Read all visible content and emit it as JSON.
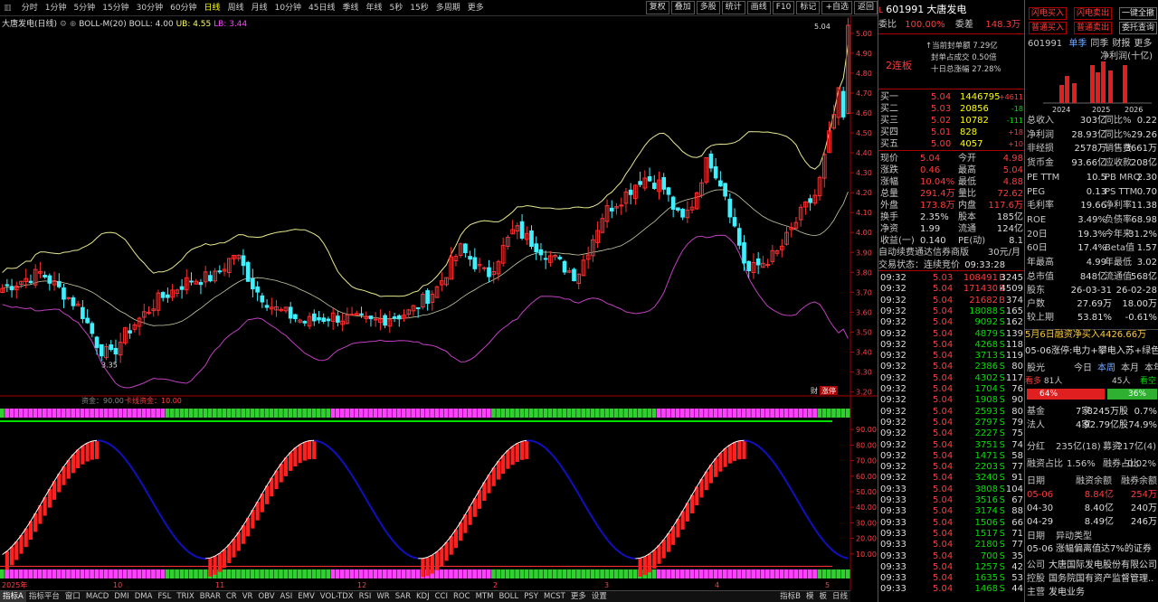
{
  "toolbar": {
    "tabs": [
      "分时",
      "1分钟",
      "5分钟",
      "15分钟",
      "30分钟",
      "60分钟",
      "日线",
      "周线",
      "月线",
      "10分钟",
      "45日线",
      "季线",
      "年线",
      "5秒",
      "15秒",
      "多周期",
      "更多"
    ],
    "active_tab": "日线",
    "buttons": [
      "复权",
      "叠加",
      "多股",
      "统计",
      "画线",
      "F10",
      "标记",
      "+自选",
      "返回"
    ]
  },
  "chart": {
    "title_name": "大唐发电(日线)",
    "indicator": "BOLL-M(20)",
    "boll": "BOLL: 4.00",
    "ub": "UB: 4.55",
    "lb": "LB: 3.44",
    "price_axis": [
      "5.00",
      "4.90",
      "4.80",
      "4.70",
      "4.60",
      "4.50",
      "4.40",
      "4.30",
      "4.20",
      "4.10",
      "4.00",
      "3.90",
      "3.80",
      "3.70",
      "3.60",
      "3.50",
      "3.40",
      "3.30",
      "3.20"
    ],
    "high_label": "5.04",
    "low_label": "3.35",
    "sub_label1": "资金：90.00",
    "sub_label2": "卡线资金：10.00",
    "osc_axis": [
      "90.00",
      "80.00",
      "70.00",
      "60.00",
      "50.00",
      "40.00",
      "30.00",
      "20.00",
      "10.00"
    ],
    "x_axis": [
      "2025年",
      "10",
      "11",
      "12",
      "2",
      "3",
      "4",
      "5"
    ],
    "corner1": "财",
    "corner2": "涨停"
  },
  "bottom_tabs": [
    "指标A",
    "指标平台",
    "窗口",
    "MACD",
    "DMI",
    "DMA",
    "FSL",
    "TRIX",
    "BRAR",
    "CR",
    "VR",
    "OBV",
    "ASI",
    "EMV",
    "VOL-TDX",
    "RSI",
    "WR",
    "SAR",
    "KDJ",
    "CCI",
    "ROC",
    "MTM",
    "BOLL",
    "PSY",
    "MCST",
    "更多",
    "设置"
  ],
  "bottom_right": [
    "指标B",
    "模",
    "板",
    "日线"
  ],
  "quote": {
    "code": "601991",
    "name": "大唐发电",
    "weibi_label": "委比",
    "weibi": "100.00%",
    "weicha_label": "委差",
    "weicha": "148.3万",
    "limit_tag": "2连板",
    "fengdan": "↑当前封单额 7.29亿",
    "fengcheng": "封单占成交 0.50倍",
    "ten_day": "十日总涨幅 27.28%",
    "asks": [
      {
        "label": "卖五",
        "price": "",
        "vol": ""
      },
      {
        "label": "卖四",
        "price": "",
        "vol": ""
      },
      {
        "label": "卖三",
        "price": "",
        "vol": ""
      },
      {
        "label": "卖二",
        "price": "",
        "vol": ""
      },
      {
        "label": "卖一",
        "price": "",
        "vol": ""
      }
    ],
    "bids": [
      {
        "label": "买一",
        "price": "5.04",
        "vol": "1446795",
        "chg": "+4611"
      },
      {
        "label": "买二",
        "price": "5.03",
        "vol": "20856",
        "chg": "-18"
      },
      {
        "label": "买三",
        "price": "5.02",
        "vol": "10782",
        "chg": "-111"
      },
      {
        "label": "买四",
        "price": "5.01",
        "vol": "828",
        "chg": "+18"
      },
      {
        "label": "买五",
        "price": "5.00",
        "vol": "4057",
        "chg": "+10"
      }
    ],
    "stats": [
      {
        "l": "现价",
        "v": "5.04",
        "l2": "今开",
        "v2": "4.98"
      },
      {
        "l": "涨跌",
        "v": "0.46",
        "l2": "最高",
        "v2": "5.04"
      },
      {
        "l": "涨幅",
        "v": "10.04%",
        "l2": "最低",
        "v2": "4.88"
      },
      {
        "l": "总量",
        "v": "291.4万",
        "l2": "量比",
        "v2": "72.62"
      },
      {
        "l": "外盘",
        "v": "173.8万",
        "l2": "内盘",
        "v2": "117.6万"
      },
      {
        "l": "换手",
        "v": "2.35%",
        "l2": "股本",
        "v2": "185亿"
      },
      {
        "l": "净资",
        "v": "1.99",
        "l2": "流通",
        "v2": "124亿"
      },
      {
        "l": "收益(一)",
        "v": "0.140",
        "l2": "PE(动)",
        "v2": "8.1"
      }
    ],
    "fee_line": "自动续费通达信券商版",
    "fee_price": "30元/月",
    "trade_status": "交易状态：连续竞价",
    "trade_time": "09:33:28",
    "ticks": [
      [
        "09:32",
        "5.03",
        "108491",
        "B",
        "3245"
      ],
      [
        "09:32",
        "5.04",
        "171430",
        "B",
        "4509"
      ],
      [
        "09:32",
        "5.04",
        "21682",
        "B",
        "374"
      ],
      [
        "09:32",
        "5.04",
        "18088",
        "S",
        "165"
      ],
      [
        "09:32",
        "5.04",
        "9092",
        "S",
        "162"
      ],
      [
        "09:32",
        "5.04",
        "4879",
        "S",
        "139"
      ],
      [
        "09:32",
        "5.04",
        "4268",
        "S",
        "118"
      ],
      [
        "09:32",
        "5.04",
        "3713",
        "S",
        "119"
      ],
      [
        "09:32",
        "5.04",
        "2386",
        "S",
        "80"
      ],
      [
        "09:32",
        "5.04",
        "4302",
        "S",
        "117"
      ],
      [
        "09:32",
        "5.04",
        "1704",
        "S",
        "76"
      ],
      [
        "09:32",
        "5.04",
        "1908",
        "S",
        "90"
      ],
      [
        "09:32",
        "5.04",
        "2593",
        "S",
        "80"
      ],
      [
        "09:32",
        "5.04",
        "2797",
        "S",
        "79"
      ],
      [
        "09:32",
        "5.04",
        "2227",
        "S",
        "75"
      ],
      [
        "09:32",
        "5.04",
        "3751",
        "S",
        "74"
      ],
      [
        "09:32",
        "5.04",
        "1471",
        "S",
        "58"
      ],
      [
        "09:32",
        "5.04",
        "2203",
        "S",
        "77"
      ],
      [
        "09:32",
        "5.04",
        "3240",
        "S",
        "91"
      ],
      [
        "09:33",
        "5.04",
        "3808",
        "S",
        "104"
      ],
      [
        "09:33",
        "5.04",
        "3516",
        "S",
        "67"
      ],
      [
        "09:33",
        "5.04",
        "3174",
        "S",
        "88"
      ],
      [
        "09:33",
        "5.04",
        "1506",
        "S",
        "66"
      ],
      [
        "09:33",
        "5.04",
        "1517",
        "S",
        "71"
      ],
      [
        "09:33",
        "5.04",
        "2180",
        "S",
        "77"
      ],
      [
        "09:33",
        "5.04",
        "700",
        "S",
        "35"
      ],
      [
        "09:33",
        "5.04",
        "1257",
        "S",
        "42"
      ],
      [
        "09:33",
        "5.04",
        "1635",
        "S",
        "53"
      ],
      [
        "09:33",
        "5.04",
        "1468",
        "S",
        "44"
      ]
    ]
  },
  "panel": {
    "top_buttons": [
      "闪电买入",
      "闪电卖出",
      "一键全撤",
      "普通买入",
      "普通卖出",
      "委托查询"
    ],
    "code": "601991",
    "tabs": [
      "单季",
      "同季",
      "财报",
      "更多"
    ],
    "fin_title": "净利润(十亿)",
    "years": [
      "2024",
      "2025",
      "2026"
    ],
    "fin_rows": [
      {
        "l": "总收入",
        "v": "303亿",
        "l2": "同比%",
        "v2": "0.22"
      },
      {
        "l": "净利润",
        "v": "28.93亿",
        "l2": "同比%",
        "v2": "29.26"
      },
      {
        "l": "非经损",
        "v": "2578万",
        "l2": "销售费",
        "v2": "3661万"
      },
      {
        "l": "货币金",
        "v": "93.66亿",
        "l2": "应收款",
        "v2": "208亿"
      },
      {
        "l": "PE TTM",
        "v": "10.5",
        "l2": "PB MRQ",
        "v2": "2.30"
      },
      {
        "l": "PEG",
        "v": "0.13",
        "l2": "PS TTM",
        "v2": "0.70"
      },
      {
        "l": "毛利率",
        "v": "19.66",
        "l2": "净利率",
        "v2": "11.38"
      },
      {
        "l": "ROE",
        "v": "3.49%",
        "l2": "负债率",
        "v2": "68.98"
      },
      {
        "l": "20日",
        "v": "19.3%",
        "l2": "今年来",
        "v2": "31.2%"
      },
      {
        "l": "60日",
        "v": "17.4%",
        "l2": "Beta值",
        "v2": "1.57"
      },
      {
        "l": "年最高",
        "v": "4.99",
        "l2": "年最低",
        "v2": "3.02"
      },
      {
        "l": "总市值",
        "v": "848亿",
        "l2": "流通值",
        "v2": "568亿"
      }
    ],
    "holders": [
      {
        "l": "股东",
        "v": "26-03-31",
        "v2": "26-02-28"
      },
      {
        "l": "户数",
        "v": "27.69万",
        "v2": "18.00万"
      },
      {
        "l": "较上期",
        "v": "53.81%",
        "v2": "-0.61%"
      }
    ],
    "margin_note": "5月6日融资净买入4426.66万",
    "news": "05-06涨停:电力+攀电入苏+绿色..",
    "sentiment_label": "股光",
    "sentiment_tabs": [
      "今日",
      "本周",
      "本月",
      "本年"
    ],
    "bull_label": "看多",
    "bull_count": "81人",
    "bear_count": "45人",
    "bear_label": "看空",
    "bull_pct": "64%",
    "bear_pct": "36%",
    "funds": [
      {
        "l": "基金",
        "v": "7家",
        "v2": "8245万股",
        "v3": "0.7%"
      },
      {
        "l": "法人",
        "v": "4家",
        "v2": "92.79亿股",
        "v3": "74.9%"
      }
    ],
    "dividend": {
      "l": "分红",
      "v": "235亿(18)",
      "l2": "募资",
      "v2": "217亿(4)"
    },
    "margin_ratio": {
      "l": "融资占比",
      "v": "1.56%",
      "l2": "融券占比",
      "v2": "0.02%"
    },
    "margin_head": [
      "日期",
      "融资余额",
      "融券余额"
    ],
    "margin_rows": [
      [
        "05-06",
        "8.84亿",
        "254万"
      ],
      [
        "04-30",
        "8.40亿",
        "240万"
      ],
      [
        "04-29",
        "8.49亿",
        "246万"
      ]
    ],
    "abn_head": [
      "日期",
      "异动类型"
    ],
    "abn_row": [
      "05-06",
      "涨幅偏离值达7%的证券"
    ],
    "company_l": "公司",
    "company": "大唐国际发电股份有限公司",
    "control_l": "控股",
    "control": "国务院国有资产监督管理..",
    "main_l": "主营",
    "main": "发电业务"
  }
}
